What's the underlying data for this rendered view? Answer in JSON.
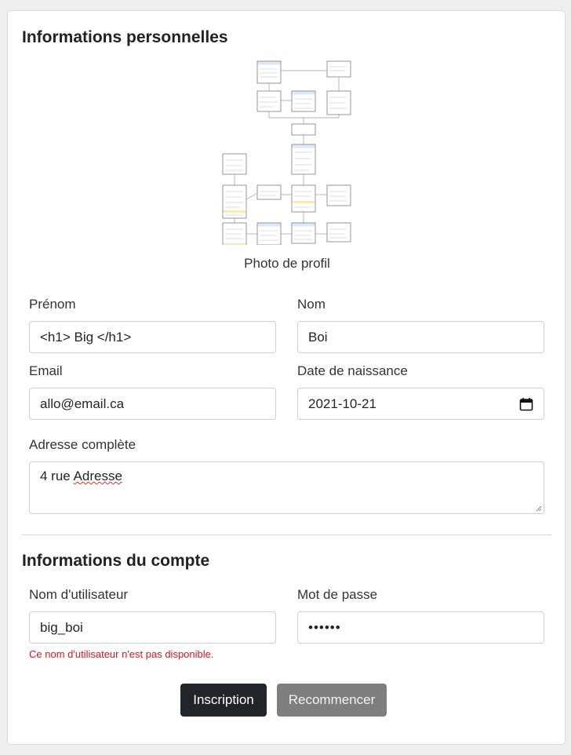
{
  "personal": {
    "section_title": "Informations personnelles",
    "photo_caption": "Photo de profil",
    "first_name": {
      "label": "Prénom",
      "value": "<h1> Big </h1>"
    },
    "last_name": {
      "label": "Nom",
      "value": "Boi"
    },
    "email": {
      "label": "Email",
      "value": "allo@email.ca"
    },
    "birth_date": {
      "label": "Date de naissance",
      "value": "2021-10-21",
      "icon": "calendar-icon"
    },
    "address": {
      "label": "Adresse complète",
      "value_word1": "4 rue",
      "value_word2": "Adresse"
    }
  },
  "account": {
    "section_title": "Informations du compte",
    "username": {
      "label": "Nom d'utilisateur",
      "value": "big_boi"
    },
    "password": {
      "label": "Mot de passe",
      "value": "••••••"
    },
    "error": "Ce nom d'utilisateur n'est pas disponible."
  },
  "actions": {
    "submit_label": "Inscription",
    "reset_label": "Recommencer"
  },
  "colors": {
    "primary_button": "#212529",
    "secondary_button": "#7e7e7e",
    "error_text": "#d9161f",
    "diagram_header": "#dce8fb"
  }
}
